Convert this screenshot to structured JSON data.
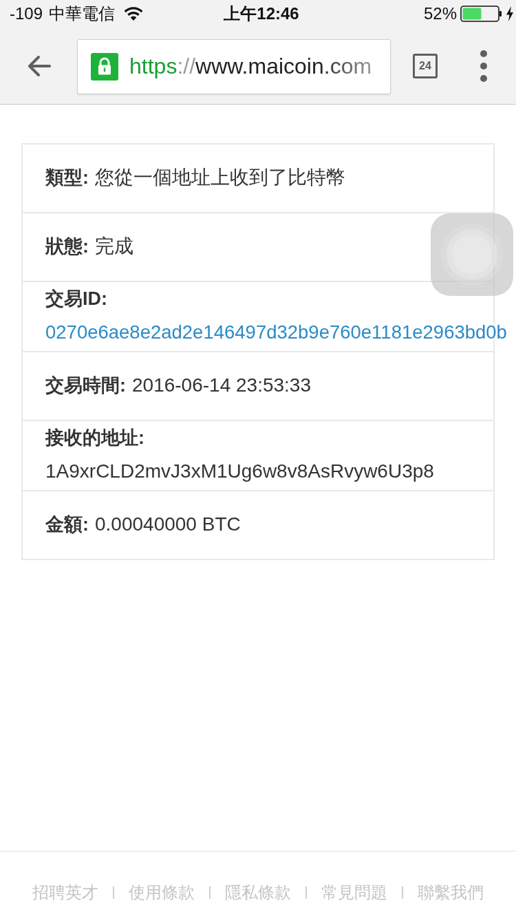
{
  "status_bar": {
    "signal_strength": "-109",
    "carrier": "中華電信",
    "time": "上午12:46",
    "battery": "52%",
    "charging": true
  },
  "browser_toolbar": {
    "address_bar": {
      "secure": true,
      "scheme": "https",
      "separator": "://",
      "host": "www.maicoin.com"
    },
    "tab_count": "24"
  },
  "transaction_details": {
    "rows": [
      {
        "kind": "inline",
        "label": "類型:",
        "value": "您從一個地址上收到了比特幣"
      },
      {
        "kind": "inline",
        "label": "狀態:",
        "value": "完成"
      },
      {
        "kind": "stacked-link",
        "label": "交易ID:",
        "value": "0270e6ae8e2ad2e146497d32b9e760e1181e2963bd0b"
      },
      {
        "kind": "inline",
        "label": "交易時間:",
        "value": "2016-06-14 23:53:33"
      },
      {
        "kind": "stacked",
        "label": "接收的地址:",
        "value": "1A9xrCLD2mvJ3xM1Ug6w8v8AsRvyw6U3p8"
      },
      {
        "kind": "inline",
        "label": "金額:",
        "value": "0.00040000 BTC"
      }
    ]
  },
  "footer": {
    "links": [
      "招聘英才",
      "使用條款",
      "隱私條款",
      "常見問題",
      "聯繫我們"
    ]
  }
}
